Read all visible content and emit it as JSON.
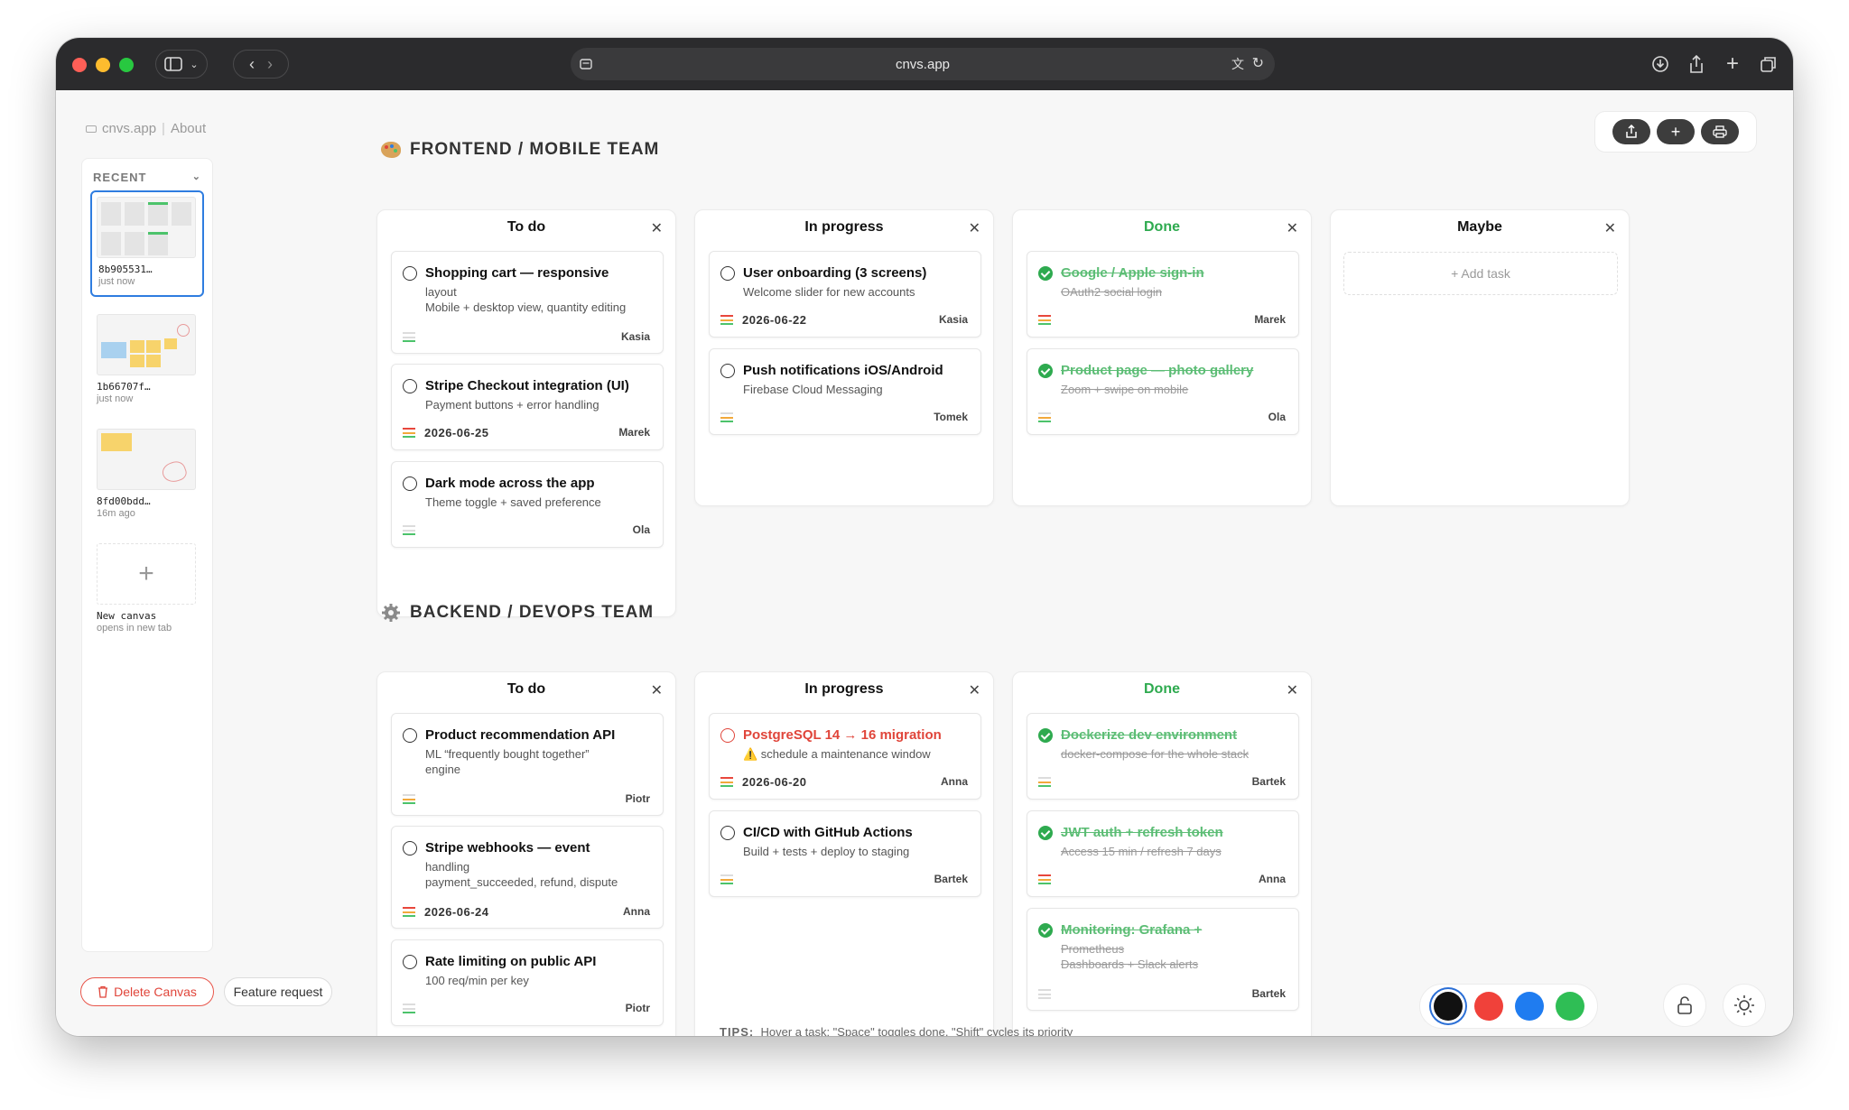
{
  "browser": {
    "url": "cnvs.app"
  },
  "breadcrumb": {
    "site": "cnvs.app",
    "about": "About"
  },
  "sidebar": {
    "recent_label": "RECENT",
    "canvases": [
      {
        "name": "8b905531…",
        "time": "just now"
      },
      {
        "name": "1b66707f…",
        "time": "just now"
      },
      {
        "name": "8fd00bdd…",
        "time": "16m ago"
      }
    ],
    "new_canvas": {
      "label": "New canvas",
      "sub": "opens in new tab"
    },
    "delete_label": "Delete Canvas",
    "feature_label": "Feature request"
  },
  "sections": {
    "frontend": "FRONTEND / MOBILE TEAM",
    "backend": "BACKEND / DEVOPS TEAM"
  },
  "frontend": {
    "todo": {
      "title": "To do",
      "cards": [
        {
          "title": "Shopping cart — responsive",
          "sub1": "layout",
          "sub2": "Mobile + desktop view, quantity editing",
          "owner": "Kasia"
        },
        {
          "title": "Stripe Checkout integration (UI)",
          "sub1": "Payment buttons + error handling",
          "date": "2026-06-25",
          "owner": "Marek"
        },
        {
          "title": "Dark mode across the app",
          "sub1": "Theme toggle + saved preference",
          "owner": "Ola"
        }
      ]
    },
    "inprogress": {
      "title": "In progress",
      "cards": [
        {
          "title": "User onboarding (3 screens)",
          "sub1": "Welcome slider for new accounts",
          "date": "2026-06-22",
          "owner": "Kasia"
        },
        {
          "title": "Push notifications iOS/Android",
          "sub1": "Firebase Cloud Messaging",
          "owner": "Tomek"
        }
      ]
    },
    "done": {
      "title": "Done",
      "cards": [
        {
          "title": "Google / Apple sign-in",
          "sub1": "OAuth2 social login",
          "owner": "Marek"
        },
        {
          "title": "Product page — photo gallery",
          "sub1": "Zoom + swipe on mobile",
          "owner": "Ola"
        }
      ]
    },
    "maybe": {
      "title": "Maybe",
      "add_label": "+ Add task"
    }
  },
  "backend": {
    "todo": {
      "title": "To do",
      "cards": [
        {
          "title": "Product recommendation API",
          "sub1": "ML “frequently bought together”",
          "sub2": "engine",
          "owner": "Piotr"
        },
        {
          "title": "Stripe webhooks — event",
          "sub1": "handling",
          "sub2": "payment_succeeded, refund, dispute",
          "date": "2026-06-24",
          "owner": "Anna"
        },
        {
          "title": "Rate limiting on public API",
          "sub1": "100 req/min per key",
          "owner": "Piotr"
        }
      ]
    },
    "inprogress": {
      "title": "In progress",
      "cards": [
        {
          "title": "PostgreSQL 14 → 16 migration",
          "sub1": "⚠️ schedule a maintenance window",
          "date": "2026-06-20",
          "owner": "Anna"
        },
        {
          "title": "CI/CD with GitHub Actions",
          "sub1": "Build + tests + deploy to staging",
          "owner": "Bartek"
        }
      ]
    },
    "done": {
      "title": "Done",
      "cards": [
        {
          "title": "Dockerize dev environment",
          "sub1": "docker-compose for the whole stack",
          "owner": "Bartek"
        },
        {
          "title": "JWT auth + refresh token",
          "sub1": "Access 15 min / refresh 7 days",
          "owner": "Anna"
        },
        {
          "title": "Monitoring: Grafana +",
          "sub1": "Prometheus",
          "sub2": "Dashboards + Slack alerts",
          "owner": "Bartek"
        }
      ]
    }
  },
  "tips": {
    "label": "TIPS:",
    "text": "Hover a task: \"Space\" toggles done, \"Shift\" cycles its priority"
  },
  "colors": {
    "palette": [
      "#111111",
      "#f0413a",
      "#1f7cf0",
      "#2fbe55"
    ],
    "done_green": "#2eaa4f",
    "priority_red": "#e8473c",
    "priority_orange": "#f2a93b",
    "priority_green": "#4cc36b"
  }
}
